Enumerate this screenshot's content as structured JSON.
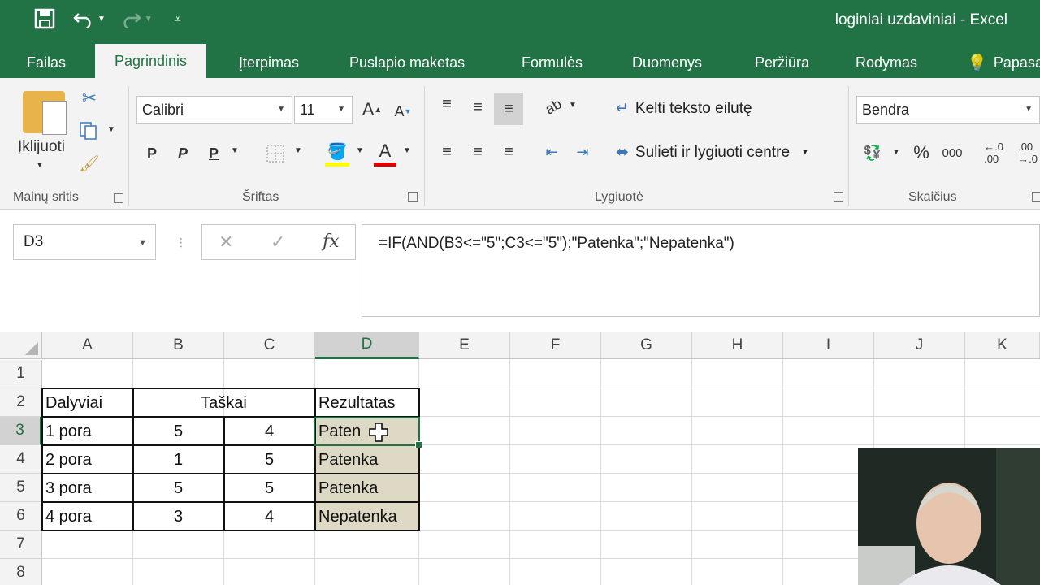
{
  "window": {
    "title": "loginiai uzdaviniai - Excel"
  },
  "qat": {
    "save_icon": "save-icon",
    "undo_icon": "undo-icon",
    "redo_icon": "redo-icon",
    "customize_icon": "customize-icon"
  },
  "tabs": [
    {
      "label": "Failas"
    },
    {
      "label": "Pagrindinis"
    },
    {
      "label": "Įterpimas"
    },
    {
      "label": "Puslapio maketas"
    },
    {
      "label": "Formulės"
    },
    {
      "label": "Duomenys"
    },
    {
      "label": "Peržiūra"
    },
    {
      "label": "Rodymas"
    },
    {
      "label": "Papasa"
    }
  ],
  "ribbon": {
    "clipboard": {
      "paste_label": "Įklijuoti",
      "group_label": "Mainų sritis"
    },
    "font": {
      "name": "Calibri",
      "size": "11",
      "bold": "P",
      "italic": "P",
      "underline": "P",
      "group_label": "Šriftas",
      "fill_color": "#ffff00",
      "font_color": "#e00000"
    },
    "alignment": {
      "wrap_label": "Kelti teksto eilutę",
      "merge_label": "Sulieti ir lygiuoti centre",
      "group_label": "Lygiuotė"
    },
    "number": {
      "format": "Bendra",
      "percent": "%",
      "thousands": "000",
      "group_label": "Skaičius"
    }
  },
  "formula_bar": {
    "name_box": "D3",
    "cancel": "✕",
    "enter": "✓",
    "fx": "fx",
    "formula": "=IF(AND(B3<=\"5\";C3<=\"5\");\"Patenka\";\"Nepatenka\")"
  },
  "sheet": {
    "columns": [
      "A",
      "B",
      "C",
      "D",
      "E",
      "F",
      "G",
      "H",
      "I",
      "J",
      "K"
    ],
    "rows": [
      "1",
      "2",
      "3",
      "4",
      "5",
      "6",
      "7",
      "8"
    ],
    "header_row": {
      "a": "Dalyviai",
      "bc": "Taškai",
      "d": "Rezultatas"
    },
    "data": [
      {
        "a": "1 pora",
        "b": "5",
        "c": "4",
        "d": "Paten"
      },
      {
        "a": "2 pora",
        "b": "1",
        "c": "5",
        "d": "Patenka"
      },
      {
        "a": "3 pora",
        "b": "5",
        "c": "5",
        "d": "Patenka"
      },
      {
        "a": "4 pora",
        "b": "3",
        "c": "4",
        "d": "Nepatenka"
      }
    ],
    "fill_color": "#ddd9c4",
    "accent": "#217346"
  }
}
